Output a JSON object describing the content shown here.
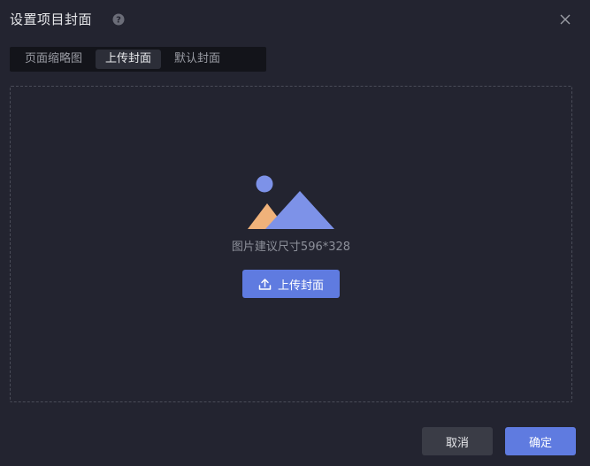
{
  "dialog": {
    "title": "设置项目封面",
    "help_icon": "question-circle-icon",
    "close_icon": "close-icon"
  },
  "tabs": [
    {
      "label": "页面缩略图",
      "active": false
    },
    {
      "label": "上传封面",
      "active": true
    },
    {
      "label": "默认封面",
      "active": false
    }
  ],
  "upload": {
    "illustration_icon": "image-placeholder-icon",
    "hint": "图片建议尺寸596*328",
    "button_icon": "upload-icon",
    "button_label": "上传封面"
  },
  "footer": {
    "cancel_label": "取消",
    "confirm_label": "确定"
  },
  "colors": {
    "background": "#232430",
    "accent": "#5f7be0",
    "sun": "#7d92e8",
    "mountain_front": "#7d92e8",
    "mountain_back": "#f0b27a"
  }
}
